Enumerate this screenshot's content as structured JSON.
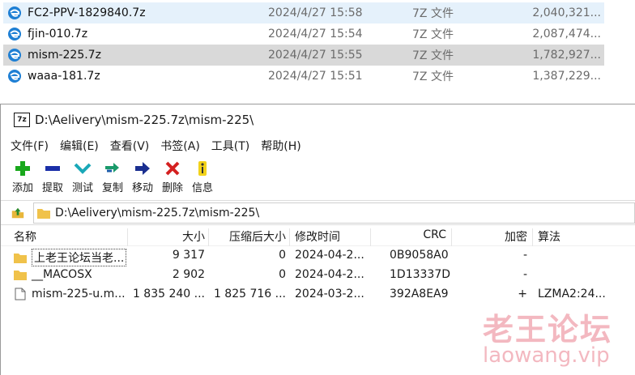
{
  "explorer": {
    "files": [
      {
        "name": "FC2-PPV-1829840.7z",
        "date": "2024/4/27 15:58",
        "type": "7Z 文件",
        "size": "2,040,321..."
      },
      {
        "name": "fjin-010.7z",
        "date": "2024/4/27 15:54",
        "type": "7Z 文件",
        "size": "2,087,474..."
      },
      {
        "name": "mism-225.7z",
        "date": "2024/4/27 15:55",
        "type": "7Z 文件",
        "size": "1,782,927..."
      },
      {
        "name": "waaa-181.7z",
        "date": "2024/4/27 15:51",
        "type": "7Z 文件",
        "size": "1,387,229..."
      }
    ]
  },
  "zip": {
    "app_icon": "7z",
    "title": "D:\\Aelivery\\mism-225.7z\\mism-225\\",
    "menu": [
      "文件(F)",
      "编辑(E)",
      "查看(V)",
      "书签(A)",
      "工具(T)",
      "帮助(H)"
    ],
    "toolbar": {
      "add": "添加",
      "extract": "提取",
      "test": "测试",
      "copy": "复制",
      "move": "移动",
      "delete": "删除",
      "info": "信息"
    },
    "path": "D:\\Aelivery\\mism-225.7z\\mism-225\\",
    "columns": {
      "name": "名称",
      "size": "大小",
      "packed": "压缩后大小",
      "modified": "修改时间",
      "crc": "CRC",
      "encrypted": "加密",
      "method": "算法"
    },
    "rows": [
      {
        "name": "上老王论坛当老...",
        "size": "9 317",
        "packed": "0",
        "modified": "2024-04-2...",
        "crc": "0B9058A0",
        "encrypted": "-",
        "method": ""
      },
      {
        "name": "__MACOSX",
        "size": "2 902",
        "packed": "0",
        "modified": "2024-04-2...",
        "crc": "1D13337D",
        "encrypted": "-",
        "method": ""
      },
      {
        "name": "mism-225-u.m...",
        "size": "1 835 240 ...",
        "packed": "1 825 716 ...",
        "modified": "2024-03-2...",
        "crc": "392A8EA9",
        "encrypted": "+",
        "method": "LZMA2:24..."
      }
    ]
  },
  "watermark": {
    "cn": "老王论坛",
    "en": "laowang.vip"
  },
  "colors": {
    "selection_light": "#e5f1fb",
    "selection_gray": "#d9d9d9",
    "watermark": "#f3b8c0",
    "add_green": "#19a81c",
    "delete_red": "#d42020"
  }
}
